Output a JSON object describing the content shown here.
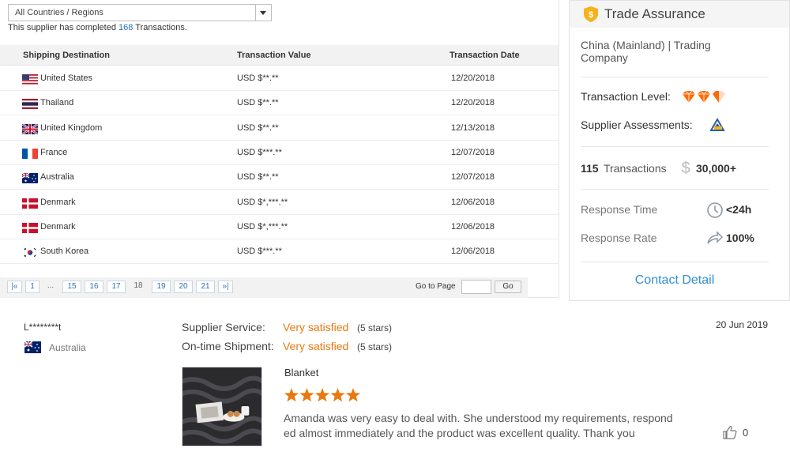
{
  "filter": {
    "selected": "All Countries / Regions"
  },
  "summary": {
    "prefix": "This supplier has completed",
    "count": "168",
    "suffix": "Transactions."
  },
  "table": {
    "headers": [
      "Shipping Destination",
      "Transaction Value",
      "Transaction Date"
    ],
    "rows": [
      {
        "country": "United States",
        "flag": "us",
        "value": "USD $**.**",
        "date": "12/20/2018"
      },
      {
        "country": "Thailand",
        "flag": "th",
        "value": "USD $**.**",
        "date": "12/20/2018"
      },
      {
        "country": "United Kingdom",
        "flag": "gb",
        "value": "USD $**.**",
        "date": "12/13/2018"
      },
      {
        "country": "France",
        "flag": "fr",
        "value": "USD $***.**",
        "date": "12/07/2018"
      },
      {
        "country": "Australia",
        "flag": "au",
        "value": "USD $**.**",
        "date": "12/07/2018"
      },
      {
        "country": "Denmark",
        "flag": "dk",
        "value": "USD $*,***.**",
        "date": "12/06/2018"
      },
      {
        "country": "Denmark",
        "flag": "dk",
        "value": "USD $*,***.**",
        "date": "12/06/2018"
      },
      {
        "country": "South Korea",
        "flag": "kr",
        "value": "USD $***.**",
        "date": "12/06/2018"
      }
    ]
  },
  "pager": {
    "first_icon": "first-page-icon",
    "pages": [
      "1",
      "...",
      "15",
      "16",
      "17",
      "18",
      "19",
      "20",
      "21"
    ],
    "current": "18",
    "last_icon": "last-page-icon",
    "goto_label": "Go to Page",
    "goto_button": "Go"
  },
  "trade": {
    "title": "Trade Assurance",
    "company": "China (Mainland)  |  Trading Company",
    "transaction_level_label": "Transaction Level:",
    "transaction_level": 2.5,
    "assessment_label": "Supplier Assessments:",
    "transactions_count": "115",
    "transactions_label": "Transactions",
    "amount": "30,000+",
    "response_time_label": "Response Time",
    "response_time": "<24h",
    "response_rate_label": "Response Rate",
    "response_rate": "100%",
    "contact": "Contact Detail"
  },
  "review": {
    "reviewer": "L********t",
    "country": "Australia",
    "service_label": "Supplier Service:",
    "service_value": "Very satisfied",
    "service_stars": "(5 stars)",
    "shipment_label": "On-time Shipment:",
    "shipment_value": "Very satisfied",
    "shipment_stars": "(5 stars)",
    "date": "20 Jun 2019",
    "product": "Blanket",
    "rating": 5,
    "text": "Amanda was very easy to deal with. She understood my requirements, respond ed almost immediately and the product was excellent quality. Thank you",
    "likes": "0"
  },
  "colors": {
    "link": "#2f6fbd",
    "accent": "#e8790f",
    "contact": "#2f8fd6",
    "diamond": "#ff6a00"
  }
}
